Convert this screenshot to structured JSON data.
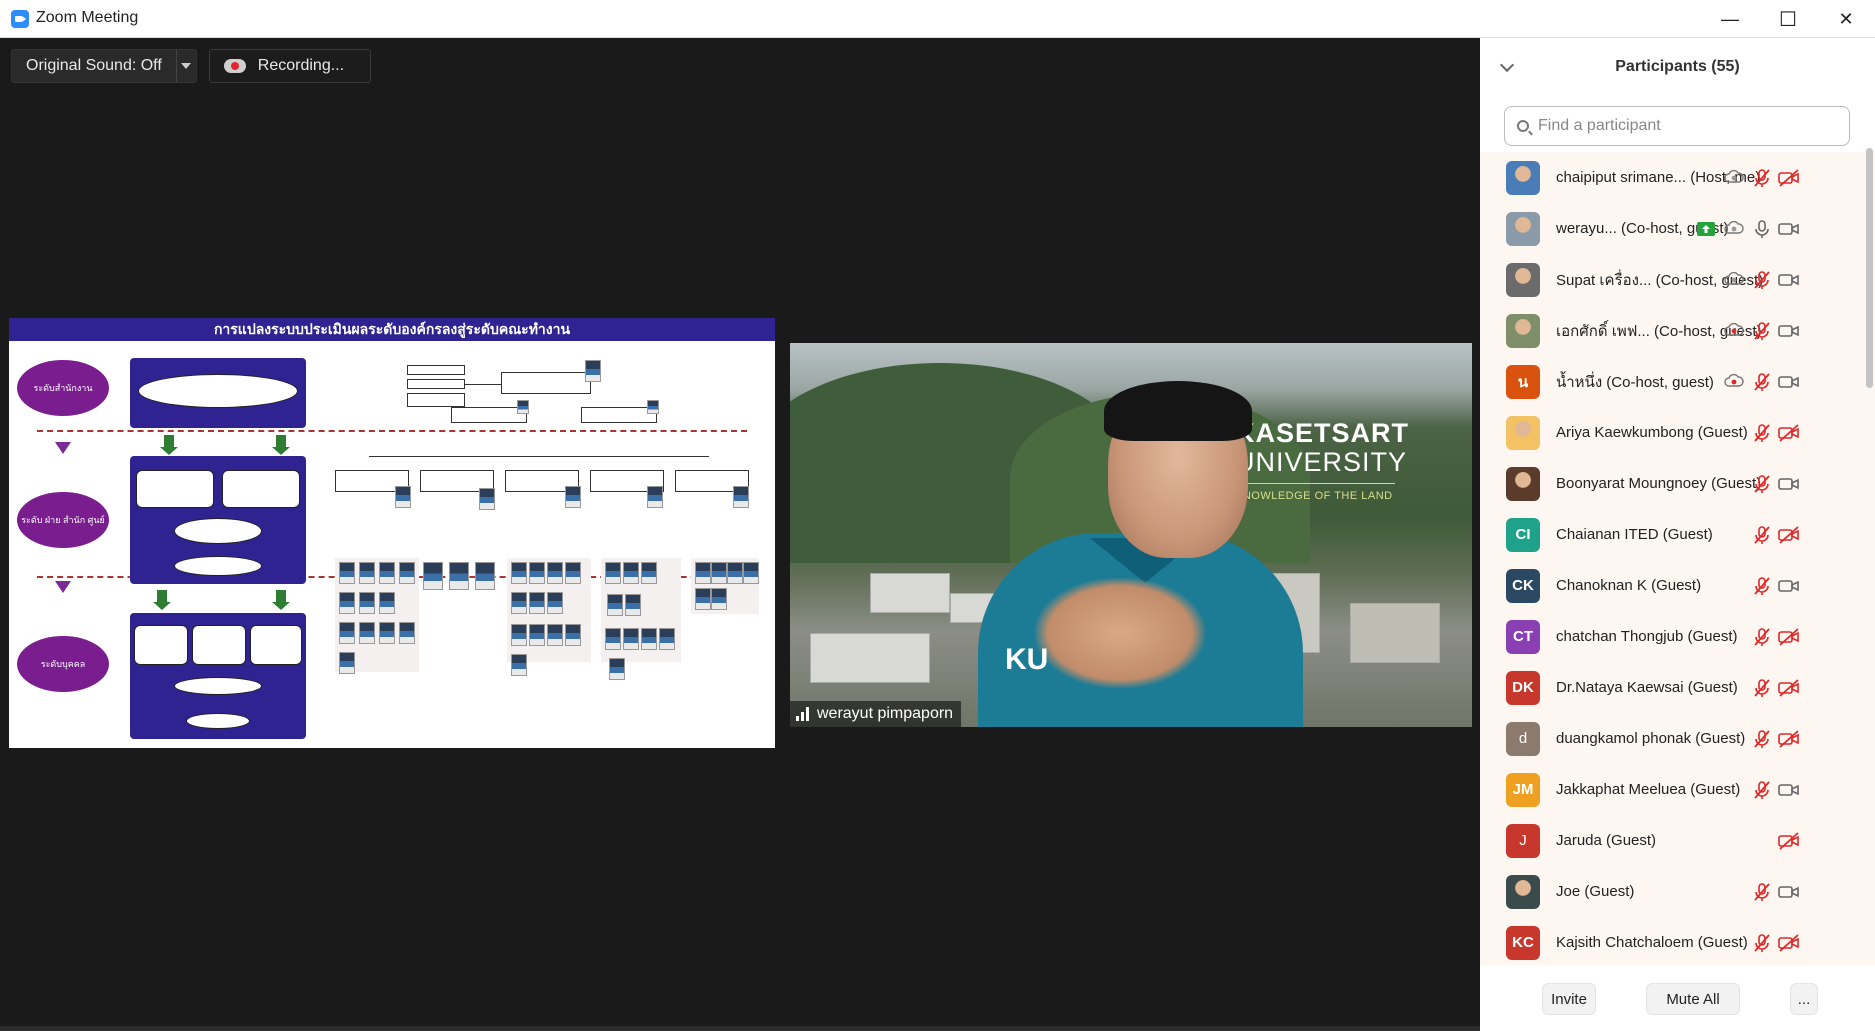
{
  "window": {
    "title": "Zoom Meeting",
    "minimize": "—",
    "maximize": "☐",
    "close": "✕"
  },
  "toolbar": {
    "original_sound": "Original Sound: Off",
    "recording": "Recording..."
  },
  "slide": {
    "title": "การแปลงระบบประเมินผลระดับองค์กรลงสู่ระดับคณะทำงาน",
    "level_office": "ระดับสำนักงาน",
    "level_dept": "ระดับ ฝ่าย สำนัก ศูนย์",
    "level_person": "ระดับบุคคล"
  },
  "video": {
    "brand_line1": "KASETSART",
    "brand_line2": "UNIVERSITY",
    "brand_tagline": "KNOWLEDGE OF THE LAND",
    "shirt_text": "KU",
    "speaker_name": "werayut pimpaporn"
  },
  "participants": {
    "header": "Participants (55)",
    "search_placeholder": "Find a participant",
    "list": [
      {
        "initials": "",
        "name": "chaipiput srimane... (Host, me)",
        "avatar_color": "#4a7db8",
        "photo": true,
        "rec": true,
        "mic": "muted",
        "cam": "off"
      },
      {
        "initials": "",
        "name": "werayu... (Co-host, guest)",
        "avatar_color": "#8a9aa8",
        "photo": true,
        "share": true,
        "rec": true,
        "mic": "on",
        "cam": "on"
      },
      {
        "initials": "",
        "name": "Supat เครื่อง... (Co-host, guest)",
        "avatar_color": "#6b6b6b",
        "photo": true,
        "rec": true,
        "mic": "muted",
        "cam": "on"
      },
      {
        "initials": "",
        "name": "เอกศักดิ์ เพฟ... (Co-host, guest)",
        "avatar_color": "#7f8f6a",
        "photo": true,
        "rec_red": true,
        "mic": "muted",
        "cam": "on"
      },
      {
        "initials": "น",
        "name": "น้ำหนึ่ง (Co-host, guest)",
        "avatar_color": "#d9530f",
        "rec_red": true,
        "mic": "muted",
        "cam": "on"
      },
      {
        "initials": "",
        "name": "Ariya Kaewkumbong (Guest)",
        "avatar_color": "#f3c265",
        "photo": true,
        "mic": "muted",
        "cam": "off"
      },
      {
        "initials": "",
        "name": "Boonyarat Moungnoey (Guest)",
        "avatar_color": "#5a3b2c",
        "photo": true,
        "mic": "muted",
        "cam": "on"
      },
      {
        "initials": "CI",
        "name": "Chaianan ITED (Guest)",
        "avatar_color": "#1fa28a",
        "mic": "muted",
        "cam": "off"
      },
      {
        "initials": "CK",
        "name": "Chanoknan K (Guest)",
        "avatar_color": "#2c4963",
        "mic": "muted",
        "cam": "on"
      },
      {
        "initials": "CT",
        "name": "chatchan Thongjub (Guest)",
        "avatar_color": "#8a3fb3",
        "mic": "muted",
        "cam": "off"
      },
      {
        "initials": "DK",
        "name": "Dr.Nataya Kaewsai (Guest)",
        "avatar_color": "#c7372c",
        "mic": "muted",
        "cam": "off"
      },
      {
        "initials": "d",
        "name": "duangkamol phonak (Guest)",
        "avatar_color": "#8d7a6e",
        "mic": "muted",
        "cam": "off"
      },
      {
        "initials": "JM",
        "name": "Jakkaphat Meeluea (Guest)",
        "avatar_color": "#f0a020",
        "mic": "muted",
        "cam": "on"
      },
      {
        "initials": "J",
        "name": "Jaruda (Guest)",
        "avatar_color": "#c7372c",
        "mic": "none",
        "cam": "off"
      },
      {
        "initials": "",
        "name": "Joe (Guest)",
        "avatar_color": "#3b4a4a",
        "photo": true,
        "mic": "muted",
        "cam": "on"
      },
      {
        "initials": "KC",
        "name": "Kajsith Chatchaloem (Guest)",
        "avatar_color": "#c7372c",
        "mic": "muted",
        "cam": "off"
      }
    ]
  },
  "footer": {
    "invite": "Invite",
    "mute_all": "Mute All",
    "more": "..."
  },
  "colors": {
    "accent": "#2d8cff",
    "muted_red": "#e02828",
    "slide_navy": "#2e2391",
    "slide_purple": "#7a1e8f"
  }
}
